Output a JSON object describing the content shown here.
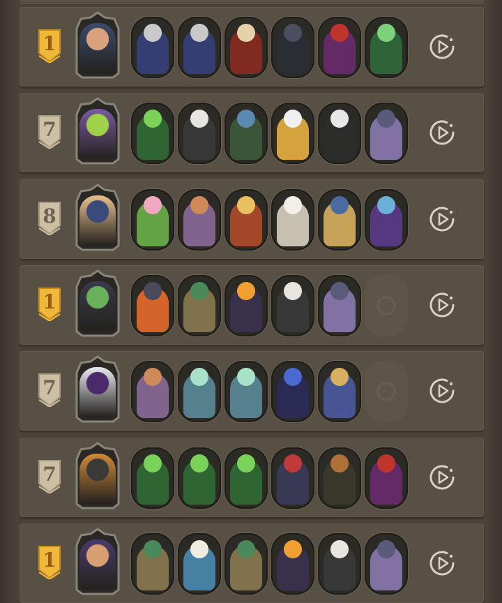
{
  "colors": {
    "row_bg": "#585044",
    "gold_badge": "#f0b83a",
    "grey_badge": "#cdbfa3"
  },
  "rows": [
    {
      "rank": "1",
      "rank_style": "gold",
      "leader": {
        "name": "leader-portrait-warrior",
        "colors": [
          "#d9a27c",
          "#3b4b6b"
        ]
      },
      "heroes": [
        {
          "name": "hero-portrait-knight-bomb",
          "colors": [
            "#c9c9c9",
            "#36407a"
          ]
        },
        {
          "name": "hero-portrait-knight-bomb",
          "colors": [
            "#c9c9c9",
            "#36407a"
          ]
        },
        {
          "name": "hero-portrait-priest-gold",
          "colors": [
            "#e6d2a8",
            "#8a2a22"
          ]
        },
        {
          "name": "hero-portrait-bomb",
          "colors": [
            "#4b5060",
            "#2a2d35"
          ]
        },
        {
          "name": "hero-portrait-jester-red",
          "colors": [
            "#c0342e",
            "#6a2a6e"
          ]
        },
        {
          "name": "hero-portrait-green-lantern",
          "colors": [
            "#7fd07a",
            "#2f6a3a"
          ]
        }
      ]
    },
    {
      "rank": "7",
      "rank_style": "grey",
      "leader": {
        "name": "leader-portrait-green-noble",
        "colors": [
          "#9fd14a",
          "#7a5aa0"
        ]
      },
      "heroes": [
        {
          "name": "hero-portrait-caterpillar",
          "colors": [
            "#7bd25a",
            "#2f6b35"
          ]
        },
        {
          "name": "hero-portrait-masked-rabbit",
          "colors": [
            "#e8e4e0",
            "#3a3a3a"
          ]
        },
        {
          "name": "hero-portrait-hat-goblin",
          "colors": [
            "#5a8ab0",
            "#3b5a3a"
          ]
        },
        {
          "name": "hero-portrait-goose",
          "colors": [
            "#f0f0f0",
            "#e8b040"
          ]
        },
        {
          "name": "hero-portrait-porcupine",
          "colors": [
            "#e8e8e8",
            "#2c2c2c"
          ]
        },
        {
          "name": "hero-portrait-kraken",
          "colors": [
            "#5a5a7a",
            "#8a7ab0"
          ]
        }
      ]
    },
    {
      "rank": "8",
      "rank_style": "grey",
      "leader": {
        "name": "leader-portrait-scholar",
        "colors": [
          "#3a4a7a",
          "#e8c090"
        ]
      },
      "heroes": [
        {
          "name": "hero-portrait-flower-fairy",
          "colors": [
            "#f0a8c0",
            "#6ab04a"
          ]
        },
        {
          "name": "hero-portrait-flower-witch",
          "colors": [
            "#d08a5a",
            "#8a6a9a"
          ]
        },
        {
          "name": "hero-portrait-puppet",
          "colors": [
            "#e8c060",
            "#b04a2a"
          ]
        },
        {
          "name": "hero-portrait-white-doll",
          "colors": [
            "#f0f0e8",
            "#d8d0c0"
          ]
        },
        {
          "name": "hero-portrait-armored-knight",
          "colors": [
            "#4a6aa0",
            "#d8b060"
          ]
        },
        {
          "name": "hero-portrait-elf-sorceress",
          "colors": [
            "#6ab0d8",
            "#5a3a8a"
          ]
        }
      ]
    },
    {
      "rank": "1",
      "rank_style": "gold",
      "leader": {
        "name": "leader-portrait-green-hood",
        "colors": [
          "#6ab05a",
          "#3a3a4a"
        ]
      },
      "heroes": [
        {
          "name": "hero-portrait-fire-bear",
          "colors": [
            "#4a4a5a",
            "#e86a2a"
          ]
        },
        {
          "name": "hero-portrait-parrot-warrior",
          "colors": [
            "#4a8a5a",
            "#8a7a50"
          ]
        },
        {
          "name": "hero-portrait-butterfly",
          "colors": [
            "#f0a030",
            "#3a3050"
          ]
        },
        {
          "name": "hero-portrait-masked-rabbit",
          "colors": [
            "#e8e4e0",
            "#3a3a3a"
          ]
        },
        {
          "name": "hero-portrait-kraken",
          "colors": [
            "#5a5a7a",
            "#8a7ab0"
          ]
        },
        {
          "name": "empty-hero-slot",
          "empty": true
        }
      ]
    },
    {
      "rank": "7",
      "rank_style": "grey",
      "leader": {
        "name": "leader-portrait-top-hat",
        "colors": [
          "#4a2a6a",
          "#e8e8f0"
        ]
      },
      "heroes": [
        {
          "name": "hero-portrait-flower-witch",
          "colors": [
            "#d08a5a",
            "#8a6a9a"
          ]
        },
        {
          "name": "hero-portrait-goat-spirit",
          "colors": [
            "#a8e0c8",
            "#5a8a9a"
          ]
        },
        {
          "name": "hero-portrait-goat-spirit",
          "colors": [
            "#a8e0c8",
            "#5a8a9a"
          ]
        },
        {
          "name": "hero-portrait-blue-sorceress",
          "colors": [
            "#4a6ad0",
            "#2a2a5a"
          ]
        },
        {
          "name": "hero-portrait-dwarf-king",
          "colors": [
            "#d8b060",
            "#4a5aa0"
          ]
        },
        {
          "name": "empty-hero-slot",
          "empty": true
        }
      ]
    },
    {
      "rank": "7",
      "rank_style": "grey",
      "leader": {
        "name": "leader-portrait-plague-doctor",
        "colors": [
          "#3a3a3a",
          "#d08a3a"
        ]
      },
      "heroes": [
        {
          "name": "hero-portrait-caterpillar",
          "colors": [
            "#7bd25a",
            "#2f6b35"
          ]
        },
        {
          "name": "hero-portrait-caterpillar",
          "colors": [
            "#7bd25a",
            "#2f6b35"
          ]
        },
        {
          "name": "hero-portrait-caterpillar",
          "colors": [
            "#7bd25a",
            "#2f6b35"
          ]
        },
        {
          "name": "hero-portrait-red-demon",
          "colors": [
            "#c03a3a",
            "#3a3a5a"
          ]
        },
        {
          "name": "hero-portrait-reindeer",
          "colors": [
            "#b0703a",
            "#3a3a2a"
          ]
        },
        {
          "name": "hero-portrait-jester-red",
          "colors": [
            "#c0342e",
            "#6a2a6e"
          ]
        }
      ]
    },
    {
      "rank": "1",
      "rank_style": "gold",
      "leader": {
        "name": "leader-portrait-gentleman",
        "colors": [
          "#d8a070",
          "#4a3a6a"
        ]
      },
      "heroes": [
        {
          "name": "hero-portrait-parrot-warrior",
          "colors": [
            "#4a8a5a",
            "#8a7a50"
          ]
        },
        {
          "name": "hero-portrait-pelican",
          "colors": [
            "#f0ece0",
            "#4a8ab0"
          ]
        },
        {
          "name": "hero-portrait-parrot-warrior",
          "colors": [
            "#4a8a5a",
            "#8a7a50"
          ]
        },
        {
          "name": "hero-portrait-butterfly",
          "colors": [
            "#f0a030",
            "#3a3050"
          ]
        },
        {
          "name": "hero-portrait-masked-rabbit",
          "colors": [
            "#e8e4e0",
            "#3a3a3a"
          ]
        },
        {
          "name": "hero-portrait-kraken",
          "colors": [
            "#5a5a7a",
            "#8a7ab0"
          ]
        }
      ]
    }
  ]
}
